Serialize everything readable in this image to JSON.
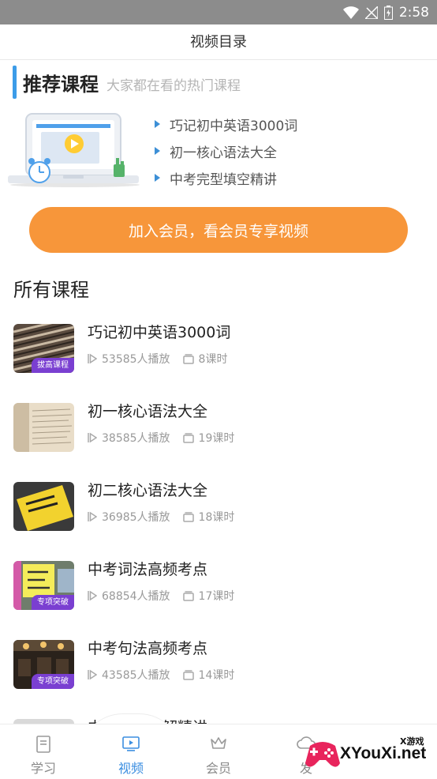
{
  "status_bar": {
    "time": "2:58"
  },
  "header": {
    "title": "视频目录"
  },
  "recommend": {
    "title": "推荐课程",
    "subtitle": "大家都在看的热门课程",
    "items": [
      {
        "label": "巧记初中英语3000词"
      },
      {
        "label": "初一核心语法大全"
      },
      {
        "label": "中考完型填空精讲"
      }
    ]
  },
  "join_button": {
    "label": "加入会员，看会员专享视频"
  },
  "all_courses": {
    "title": "所有课程",
    "courses": [
      {
        "title": "巧记初中英语3000词",
        "plays": "53585人播放",
        "lessons": "8课时",
        "tag": "拔高课程"
      },
      {
        "title": "初一核心语法大全",
        "plays": "38585人播放",
        "lessons": "19课时",
        "tag": ""
      },
      {
        "title": "初二核心语法大全",
        "plays": "36985人播放",
        "lessons": "18课时",
        "tag": ""
      },
      {
        "title": "中考词法高频考点",
        "plays": "68854人播放",
        "lessons": "17课时",
        "tag": "专项突破"
      },
      {
        "title": "中考句法高频考点",
        "plays": "43585人播放",
        "lessons": "14课时",
        "tag": "专项突破"
      },
      {
        "title": "中考阅读理解精讲"
      }
    ]
  },
  "tabbar": {
    "tabs": [
      {
        "label": "学习"
      },
      {
        "label": "视频"
      },
      {
        "label": "会员"
      },
      {
        "label": "发"
      }
    ],
    "active": "视频"
  },
  "watermark": {
    "brand": "XYouXi.net",
    "small": "X游戏"
  },
  "colors": {
    "accent": "#3b8ee0",
    "button": "#f7963a",
    "tag": "#7a3fd1"
  }
}
